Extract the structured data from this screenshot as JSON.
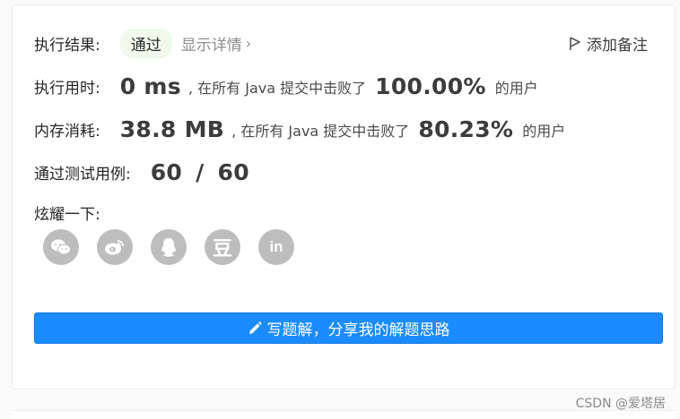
{
  "result": {
    "label": "执行结果:",
    "status": "通过",
    "detail_link": "显示详情",
    "add_note": "添加备注"
  },
  "runtime": {
    "label": "执行用时:",
    "value": "0 ms",
    "middle": ", 在所有 Java 提交中击败了",
    "percent": "100.00%",
    "suffix": "的用户"
  },
  "memory": {
    "label": "内存消耗:",
    "value": "38.8 MB",
    "middle": ", 在所有 Java 提交中击败了",
    "percent": "80.23%",
    "suffix": "的用户"
  },
  "tests": {
    "label": "通过测试用例:",
    "value": "60 / 60"
  },
  "share": {
    "label": "炫耀一下:",
    "icons": [
      "wechat-icon",
      "weibo-icon",
      "qq-icon",
      "douban-icon",
      "linkedin-icon"
    ],
    "douban_glyph": "豆",
    "linkedin_glyph": "in"
  },
  "solution_button": "写题解，分享我的解题思路",
  "watermark": "CSDN @爱塔居",
  "colors": {
    "accent": "#1a8cff",
    "pass_bg": "#f0f9eb",
    "icon_gray": "#bdbdbd"
  }
}
